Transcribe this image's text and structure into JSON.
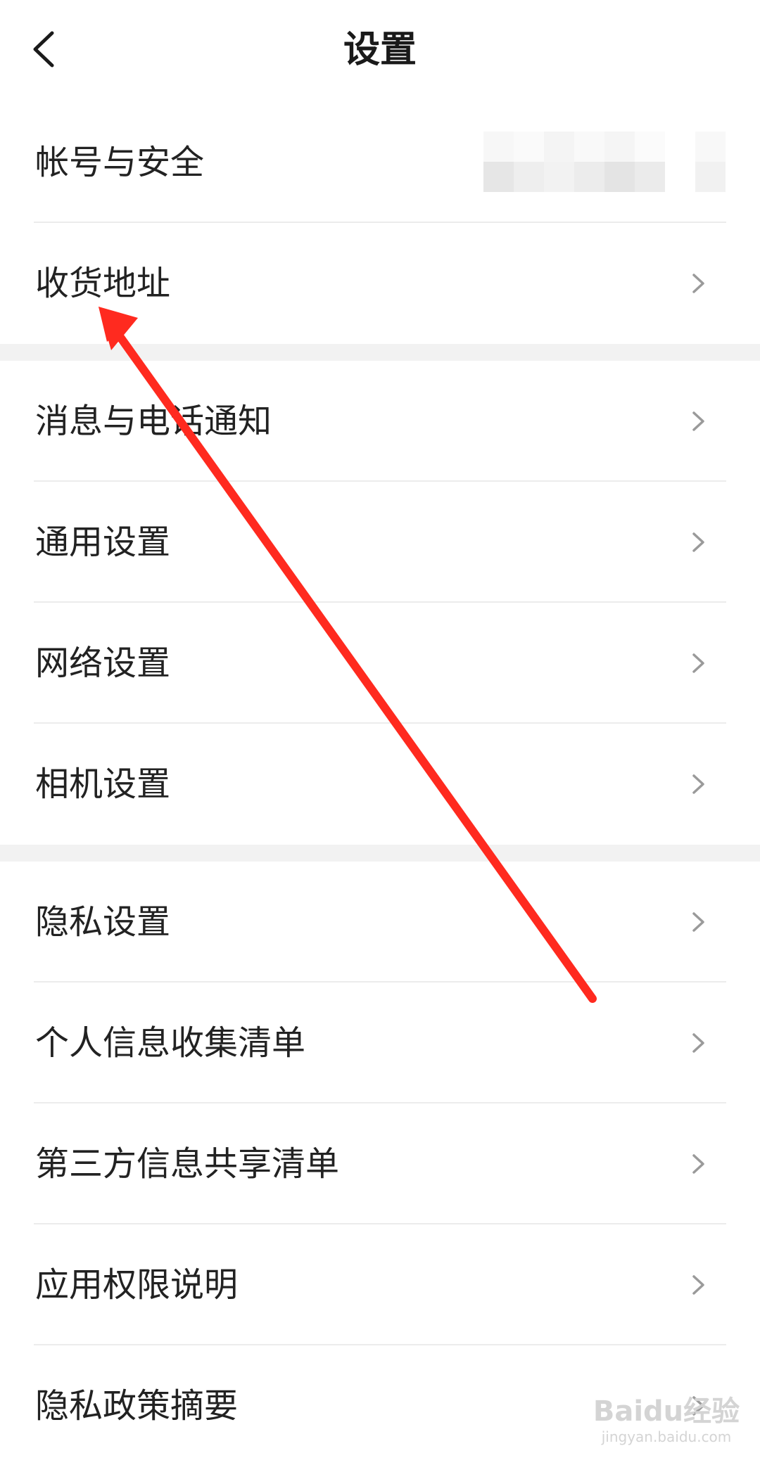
{
  "header": {
    "title": "设置",
    "back_icon": "chevron-left-icon"
  },
  "groups": [
    {
      "items": [
        {
          "label": "帐号与安全",
          "value": "",
          "value_masked": true,
          "chevron": false
        },
        {
          "label": "收货地址",
          "chevron": true
        }
      ]
    },
    {
      "items": [
        {
          "label": "消息与电话通知",
          "chevron": true
        },
        {
          "label": "通用设置",
          "chevron": true
        },
        {
          "label": "网络设置",
          "chevron": true
        },
        {
          "label": "相机设置",
          "chevron": true
        }
      ]
    },
    {
      "items": [
        {
          "label": "隐私设置",
          "chevron": true
        },
        {
          "label": "个人信息收集清单",
          "chevron": true
        },
        {
          "label": "第三方信息共享清单",
          "chevron": true
        },
        {
          "label": "应用权限说明",
          "chevron": true
        },
        {
          "label": "隐私政策摘要",
          "chevron": true
        }
      ]
    }
  ],
  "colors": {
    "text": "#222222",
    "divider": "#ececec",
    "section_gap": "#f2f2f2",
    "chevron": "#9a9a9a",
    "annotation": "#ff2a1f"
  },
  "watermark": {
    "logo": "Baidu经验",
    "site": "jingyan.baidu.com"
  }
}
